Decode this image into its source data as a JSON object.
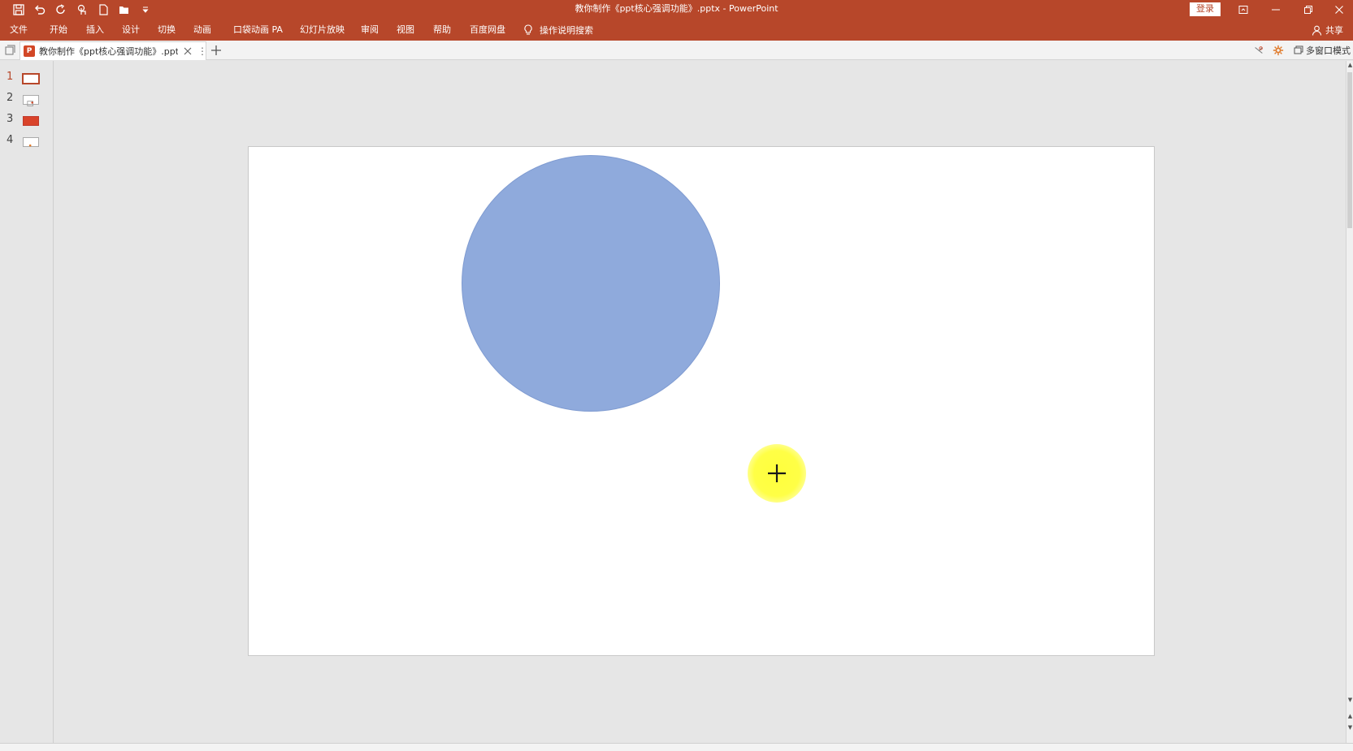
{
  "window": {
    "title": "教你制作《ppt核心强调功能》.pptx  -  PowerPoint",
    "login_label": "登录"
  },
  "quick_access": {
    "icons": [
      "save-icon",
      "undo-icon",
      "redo-icon",
      "touch-mode-icon",
      "new-file-icon",
      "open-folder-icon",
      "customize-qat-icon"
    ]
  },
  "ribbon": {
    "tabs": [
      {
        "label": "文件"
      },
      {
        "label": "开始"
      },
      {
        "label": "插入"
      },
      {
        "label": "设计"
      },
      {
        "label": "切换"
      },
      {
        "label": "动画"
      },
      {
        "label": "口袋动画 PA"
      },
      {
        "label": "幻灯片放映"
      },
      {
        "label": "审阅"
      },
      {
        "label": "视图"
      },
      {
        "label": "帮助"
      },
      {
        "label": "百度网盘"
      }
    ],
    "tell_me": "操作说明搜索",
    "share": "共享"
  },
  "doc_tabs": {
    "active_tab": "教你制作《ppt核心强调功能》.pptx",
    "multi_window": "多窗口模式"
  },
  "thumbnails": [
    {
      "number": "1",
      "active": true
    },
    {
      "number": "2",
      "active": false
    },
    {
      "number": "3",
      "active": false
    },
    {
      "number": "4",
      "active": false
    }
  ],
  "colors": {
    "accent": "#b7472a",
    "circle_fill": "#8faadc",
    "cursor_highlight": "#ffff3c"
  }
}
